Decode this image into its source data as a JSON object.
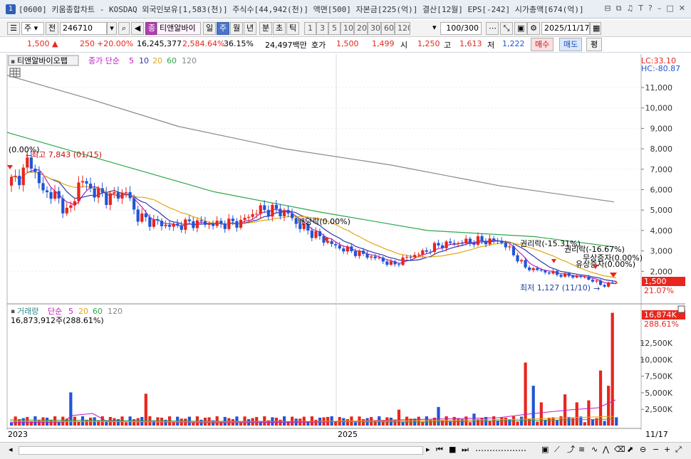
{
  "window": {
    "number": "1",
    "title": "[0600] 키움종합차트 - KOSDAQ 외국인보유[1,583(천)] 주식수[44,942(천)] 액면[500] 자본금[225(억)] 결산[12월] EPS[-242] 시가총액[674(억)]",
    "icons": [
      "restore-icon",
      "copy-icon",
      "bell-icon",
      "text-icon",
      "help-icon",
      "minimize-icon",
      "maximize-icon",
      "close-icon"
    ]
  },
  "toolbar": {
    "period_select": "주",
    "prev_label": "전",
    "code": "246710",
    "stock_name": "티앤알바이",
    "stock_badge": "종",
    "intervals": [
      "일",
      "주",
      "월",
      "년",
      "분",
      "초",
      "틱"
    ],
    "active_interval": "주",
    "minutes": [
      "1",
      "3",
      "5",
      "10",
      "20",
      "30",
      "60",
      "120"
    ],
    "count": "100/300",
    "date": "2025/11/17"
  },
  "quote": {
    "price": "1,500",
    "arrow": "▲",
    "change": "250",
    "change_pct": "+20.00%",
    "volume": "16,245,377",
    "volume_ratio": "2,584.64%",
    "turnover": "36.15%",
    "amount": "24,497백만",
    "hoga_label": "호가",
    "ask": "1,500",
    "bid": "1,499",
    "open_label": "시",
    "open": "1,250",
    "high_label": "고",
    "high": "1,613",
    "low_label": "저",
    "low": "1,222",
    "buy_label": "매수",
    "sell_label": "매도",
    "avg_label": "평"
  },
  "price_panel": {
    "name_badge": "티앤알바이오팹",
    "ma_label": "종가 단순",
    "ma_periods": [
      "5",
      "10",
      "20",
      "60",
      "120"
    ],
    "lc_text": "LC:33.10",
    "hc_text": "HC:-80.87",
    "y_ticks": [
      "11,000",
      "10,000",
      "9,000",
      "8,000",
      "7,000",
      "6,000",
      "5,000",
      "4,000",
      "3,000",
      "2,000"
    ],
    "current_price_tag": "1,500",
    "current_pct_tag": "21.07%",
    "annotations": {
      "zero_pct": "(0.00%)",
      "high": "최고 7,843 (01/15)",
      "dividend": "배당락(0.00%)",
      "rights1": "권리락(-15.31%)",
      "rights2": "권리락(-16.67%)",
      "bonus": "무상증자(0.00%)",
      "bonus2": "유상증자(0.00%)",
      "low": "최저 1,127 (11/10)"
    }
  },
  "volume_panel": {
    "title": "거래량",
    "ma_label": "단순",
    "ma_periods": [
      "5",
      "20",
      "60",
      "120"
    ],
    "value_text": "16,873,912주(288.61%)",
    "tag_value": "16,874K",
    "tag_pct": "288.61%",
    "y_ticks": [
      "12,500K",
      "10,000K",
      "7,500K",
      "5,000K",
      "2,500K"
    ]
  },
  "x_axis": {
    "labels": [
      "2023",
      "2025"
    ],
    "last_label": "11/17"
  },
  "colors": {
    "up": "#e8261d",
    "down": "#1f56d6",
    "ma5": "#c01cc0",
    "ma10": "#2a3aa8",
    "ma20": "#e6a514",
    "ma60": "#2ea84a",
    "ma120": "#888888",
    "accent": "#4a74c9"
  }
}
